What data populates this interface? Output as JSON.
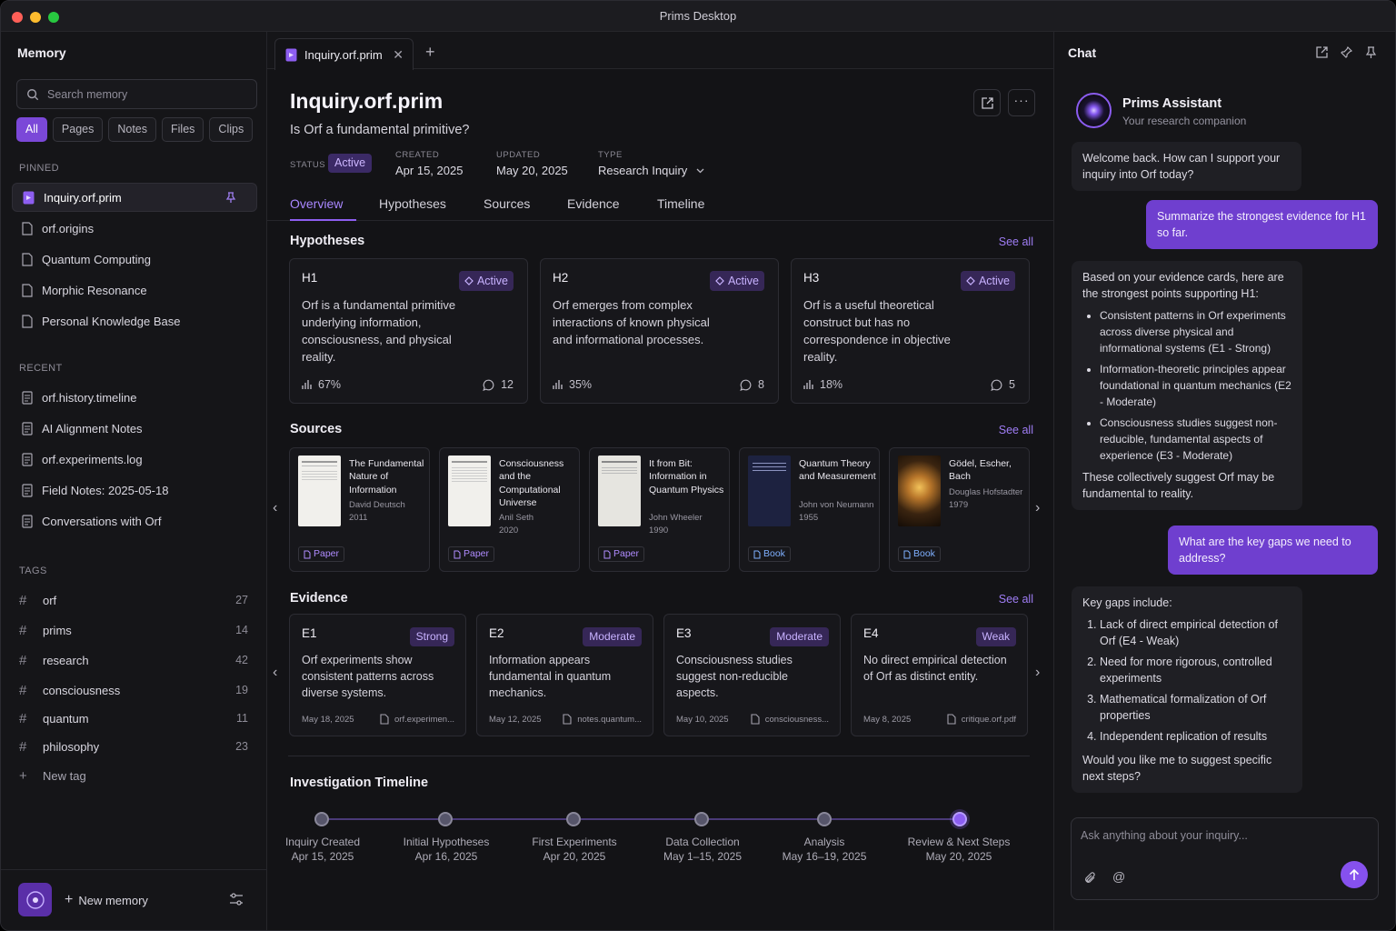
{
  "window": {
    "title": "Prims Desktop"
  },
  "sidebar": {
    "title": "Memory",
    "search_placeholder": "Search memory",
    "filters": [
      "All",
      "Pages",
      "Notes",
      "Files",
      "Clips"
    ],
    "pinned_label": "PINNED",
    "pinned": [
      {
        "label": "Inquiry.orf.prim"
      },
      {
        "label": "orf.origins"
      },
      {
        "label": "Quantum Computing"
      },
      {
        "label": "Morphic Resonance"
      },
      {
        "label": "Personal Knowledge Base"
      }
    ],
    "recent_label": "RECENT",
    "recent": [
      {
        "label": "orf.history.timeline"
      },
      {
        "label": "AI Alignment Notes"
      },
      {
        "label": "orf.experiments.log"
      },
      {
        "label": "Field Notes: 2025-05-18"
      },
      {
        "label": "Conversations with Orf"
      }
    ],
    "tags_label": "TAGS",
    "tags": [
      {
        "name": "orf",
        "count": "27"
      },
      {
        "name": "prims",
        "count": "14"
      },
      {
        "name": "research",
        "count": "42"
      },
      {
        "name": "consciousness",
        "count": "19"
      },
      {
        "name": "quantum",
        "count": "11"
      },
      {
        "name": "philosophy",
        "count": "23"
      }
    ],
    "new_tag": "New tag",
    "new_memory": "New memory"
  },
  "main": {
    "tab_label": "Inquiry.orf.prim",
    "title": "Inquiry.orf.prim",
    "subtitle": "Is Orf a fundamental primitive?",
    "meta": {
      "status_label": "STATUS",
      "status": "Active",
      "created_label": "CREATED",
      "created": "Apr 15, 2025",
      "updated_label": "UPDATED",
      "updated": "May 20, 2025",
      "type_label": "TYPE",
      "type": "Research Inquiry"
    },
    "tabs": [
      "Overview",
      "Hypotheses",
      "Sources",
      "Evidence",
      "Timeline"
    ],
    "see_all": "See all",
    "hypotheses_title": "Hypotheses",
    "hypotheses": [
      {
        "id": "H1",
        "status": "Active",
        "text": "Orf is a fundamental primitive underlying information, consciousness, and physical reality.",
        "pct": "67%",
        "comments": "12"
      },
      {
        "id": "H2",
        "status": "Active",
        "text": "Orf emerges from complex interactions of known physical and informational  processes.",
        "pct": "35%",
        "comments": "8"
      },
      {
        "id": "H3",
        "status": "Active",
        "text": "Orf is a useful theoretical construct but has no correspondence in objective reality.",
        "pct": "18%",
        "comments": "5"
      }
    ],
    "sources_title": "Sources",
    "sources": [
      {
        "title": "The Fundamental Nature of Information",
        "author": "David Deutsch",
        "year": "2011",
        "type": "Paper"
      },
      {
        "title": "Consciousness and the Computational Universe",
        "author": "Anil Seth",
        "year": "2020",
        "type": "Paper"
      },
      {
        "title": "It from Bit: Information in Quantum Physics",
        "author": "John Wheeler",
        "year": "1990",
        "type": "Paper"
      },
      {
        "title": "Quantum Theory and Measurement",
        "author": "John von Neumann",
        "year": "1955",
        "type": "Book"
      },
      {
        "title": "Gödel, Escher, Bach",
        "author": "Douglas Hofstadter",
        "year": "1979",
        "type": "Book"
      }
    ],
    "evidence_title": "Evidence",
    "evidence": [
      {
        "id": "E1",
        "strength": "Strong",
        "text": "Orf experiments show consistent patterns across diverse systems.",
        "date": "May 18, 2025",
        "file": "orf.experimen..."
      },
      {
        "id": "E2",
        "strength": "Moderate",
        "text": "Information appears fundamental in quantum mechanics.",
        "date": "May 12, 2025",
        "file": "notes.quantum..."
      },
      {
        "id": "E3",
        "strength": "Moderate",
        "text": "Consciousness studies suggest non-reducible aspects.",
        "date": "May 10, 2025",
        "file": "consciousness..."
      },
      {
        "id": "E4",
        "strength": "Weak",
        "text": "No direct empirical detection of Orf as distinct entity.",
        "date": "May 8, 2025",
        "file": "critique.orf.pdf"
      }
    ],
    "timeline_title": "Investigation Timeline",
    "timeline": [
      {
        "label": "Inquiry Created",
        "date": "Apr 15, 2025"
      },
      {
        "label": "Initial Hypotheses",
        "date": "Apr 16, 2025"
      },
      {
        "label": "First Experiments",
        "date": "Apr 20, 2025"
      },
      {
        "label": "Data Collection",
        "date": "May 1–15, 2025"
      },
      {
        "label": "Analysis",
        "date": "May 16–19, 2025"
      },
      {
        "label": "Review & Next Steps",
        "date": "May 20, 2025"
      }
    ]
  },
  "chat": {
    "title": "Chat",
    "assistant_name": "Prims Assistant",
    "assistant_sub": "Your research companion",
    "m1": "Welcome back. How can I support your inquiry into Orf today?",
    "m2": "Summarize the strongest evidence for H1 so far.",
    "m3_intro": "Based on your evidence cards, here are the strongest points supporting H1:",
    "m3_points": [
      "Consistent patterns in Orf experiments across diverse physical and informational systems (E1 - Strong)",
      "Information-theoretic principles appear foundational in quantum mechanics (E2 - Moderate)",
      "Consciousness studies suggest non-reducible, fundamental aspects of experience (E3 - Moderate)"
    ],
    "m3_outro": "These collectively suggest Orf may be fundamental to reality.",
    "m4": "What are the key gaps we need to address?",
    "m5_intro": "Key gaps include:",
    "m5_points": [
      "Lack of direct empirical detection of Orf (E4 - Weak)",
      "Need for more rigorous, controlled experiments",
      "Mathematical formalization of Orf properties",
      "Independent replication of results"
    ],
    "m5_outro": "Would you like me to suggest specific next steps?",
    "input_placeholder": "Ask anything about your inquiry..."
  },
  "colors": {
    "accent": "#8d5ef0",
    "bg": "#131316",
    "panel": "#151518"
  }
}
